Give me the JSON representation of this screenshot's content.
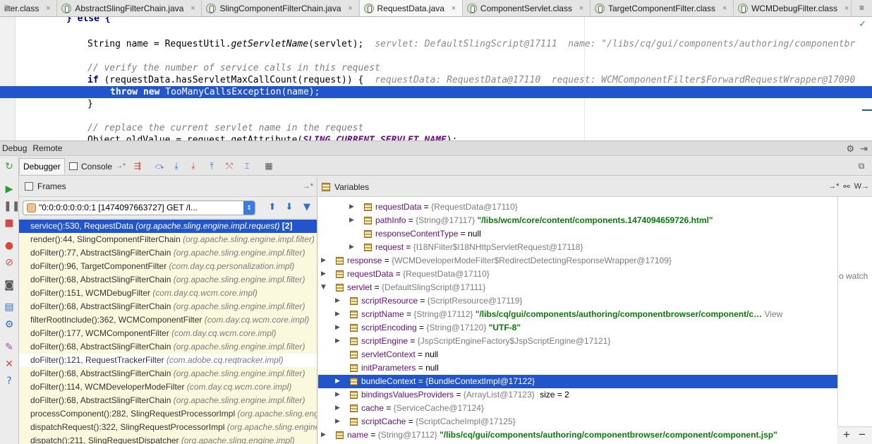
{
  "tabs": [
    {
      "label": "ilter.class",
      "active": false
    },
    {
      "label": "AbstractSlingFilterChain.java",
      "active": false
    },
    {
      "label": "SlingComponentFilterChain.java",
      "active": false
    },
    {
      "label": "RequestData.java",
      "active": true
    },
    {
      "label": "ComponentServlet.class",
      "active": false
    },
    {
      "label": "TargetComponentFilter.class",
      "active": false
    },
    {
      "label": "WCMDebugFilter.class",
      "active": false
    }
  ],
  "tab_overflow": "≡",
  "editor": {
    "line0": "} else {",
    "line1_code_a": "String name = RequestUtil.",
    "line1_method": "getServletName",
    "line1_code_b": "(servlet);",
    "line1_inline": "servlet: DefaultSlingScript@17111  name: \"/libs/cq/gui/components/authoring/componentbr",
    "line2_comment": "// verify the number of service calls in this request",
    "line3_kw": "if",
    "line3_code": " (requestData.hasServletMaxCallCount(request)) {",
    "line3_inline": "requestData: RequestData@17110  request: WCMComponentFilter$ForwardRequestWrapper@17090",
    "line4_kw": "throw new",
    "line4_code": " TooManyCallsException(name);",
    "line5": "}",
    "line6_comment": "// replace the current servlet name in the request",
    "line7_code": "Object oldValue = request.getAttribute(",
    "line7_const": "SLING_CURRENT_SERVLET_NAME",
    "line7_end": ");"
  },
  "debug_bar": {
    "title": "Debug",
    "config": "Remote"
  },
  "debugger_tabs": {
    "debugger": "Debugger",
    "console": "Console",
    "console_pin": "→*"
  },
  "frames": {
    "title": "Frames",
    "pin": "→*",
    "thread": "\"0:0:0:0:0:0:0:1 [1474097663727] GET /l...",
    "items": [
      {
        "method": "service():530, RequestData",
        "pkg": "(org.apache.sling.engine.impl.request)",
        "count": "[2]",
        "selected": true,
        "white": false
      },
      {
        "method": "render():44, SlingComponentFilterChain",
        "pkg": "(org.apache.sling.engine.impl.filter)",
        "count": "",
        "selected": false,
        "white": false
      },
      {
        "method": "doFilter():77, AbstractSlingFilterChain",
        "pkg": "(org.apache.sling.engine.impl.filter)",
        "count": "",
        "selected": false,
        "white": false
      },
      {
        "method": "doFilter():96, TargetComponentFilter",
        "pkg": "(com.day.cq.personalization.impl)",
        "count": "",
        "selected": false,
        "white": false
      },
      {
        "method": "doFilter():68, AbstractSlingFilterChain",
        "pkg": "(org.apache.sling.engine.impl.filter)",
        "count": "",
        "selected": false,
        "white": false
      },
      {
        "method": "doFilter():151, WCMDebugFilter",
        "pkg": "(com.day.cq.wcm.core.impl)",
        "count": "",
        "selected": false,
        "white": false
      },
      {
        "method": "doFilter():68, AbstractSlingFilterChain",
        "pkg": "(org.apache.sling.engine.impl.filter)",
        "count": "",
        "selected": false,
        "white": false
      },
      {
        "method": "filterRootInclude():362, WCMComponentFilter",
        "pkg": "(com.day.cq.wcm.core.impl)",
        "count": "",
        "selected": false,
        "white": false
      },
      {
        "method": "doFilter():177, WCMComponentFilter",
        "pkg": "(com.day.cq.wcm.core.impl)",
        "count": "",
        "selected": false,
        "white": false
      },
      {
        "method": "doFilter():68, AbstractSlingFilterChain",
        "pkg": "(org.apache.sling.engine.impl.filter)",
        "count": "",
        "selected": false,
        "white": false
      },
      {
        "method": "doFilter():121, RequestTrackerFilter",
        "pkg": "(com.adobe.cq.reqtracker.impl)",
        "count": "",
        "selected": false,
        "white": true
      },
      {
        "method": "doFilter():68, AbstractSlingFilterChain",
        "pkg": "(org.apache.sling.engine.impl.filter)",
        "count": "",
        "selected": false,
        "white": false
      },
      {
        "method": "doFilter():114, WCMDeveloperModeFilter",
        "pkg": "(com.day.cq.wcm.core.impl)",
        "count": "",
        "selected": false,
        "white": false
      },
      {
        "method": "doFilter():68, AbstractSlingFilterChain",
        "pkg": "(org.apache.sling.engine.impl.filter)",
        "count": "",
        "selected": false,
        "white": false
      },
      {
        "method": "processComponent():282, SlingRequestProcessorImpl",
        "pkg": "(org.apache.sling.engine.impl)",
        "count": "",
        "selected": false,
        "white": false
      },
      {
        "method": "dispatchRequest():322, SlingRequestProcessorImpl",
        "pkg": "(org.apache.sling.engine.impl)",
        "count": "",
        "selected": false,
        "white": false
      },
      {
        "method": "dispatch():211, SlingRequestDispatcher",
        "pkg": "(org.apache.sling.engine.impl)",
        "count": "",
        "selected": false,
        "white": false
      }
    ]
  },
  "variables": {
    "title": "Variables",
    "pin": "→*",
    "watches_short": "W→",
    "watch_hint": "o watch",
    "items": [
      {
        "depth": 2,
        "expandable": true,
        "name": "requestData",
        "type": "{RequestData@17110}",
        "value": "",
        "extra": "",
        "selected": false
      },
      {
        "depth": 2,
        "expandable": true,
        "name": "pathInfo",
        "type": "{String@17117}",
        "value": "\"/libs/wcm/core/content/components.1474094659726.html\"",
        "extra": "",
        "selected": false
      },
      {
        "depth": 2,
        "expandable": false,
        "name": "responseContentType",
        "type": "",
        "value": "null",
        "extra": "",
        "selected": false
      },
      {
        "depth": 2,
        "expandable": true,
        "name": "request",
        "type": "{I18NFilter$I18NHttpServletRequest@17118}",
        "value": "",
        "extra": "",
        "selected": false
      },
      {
        "depth": 0,
        "expandable": true,
        "name": "response",
        "type": "{WCMDeveloperModeFilter$RedirectDetectingResponseWrapper@17109}",
        "value": "",
        "extra": "",
        "selected": false
      },
      {
        "depth": 0,
        "expandable": true,
        "name": "requestData",
        "type": "{RequestData@17110}",
        "value": "",
        "extra": "",
        "selected": false
      },
      {
        "depth": 0,
        "expandable": true,
        "expanded": true,
        "name": "servlet",
        "type": "{DefaultSlingScript@17111}",
        "value": "",
        "extra": "",
        "selected": false
      },
      {
        "depth": 1,
        "expandable": true,
        "name": "scriptResource",
        "type": "{ScriptResource@17119}",
        "value": "",
        "extra": "",
        "selected": false
      },
      {
        "depth": 1,
        "expandable": true,
        "name": "scriptName",
        "type": "{String@17112}",
        "value": "\"/libs/cq/gui/components/authoring/componentbrowser/component/c…",
        "extra": "View",
        "selected": false
      },
      {
        "depth": 1,
        "expandable": true,
        "name": "scriptEncoding",
        "type": "{String@17120}",
        "value": "\"UTF-8\"",
        "extra": "",
        "selected": false
      },
      {
        "depth": 1,
        "expandable": true,
        "name": "scriptEngine",
        "type": "{JspScriptEngineFactory$JspScriptEngine@17121}",
        "value": "",
        "extra": "",
        "selected": false
      },
      {
        "depth": 1,
        "expandable": false,
        "name": "servletContext",
        "type": "",
        "value": "null",
        "extra": "",
        "selected": false
      },
      {
        "depth": 1,
        "expandable": false,
        "name": "initParameters",
        "type": "",
        "value": "null",
        "extra": "",
        "selected": false
      },
      {
        "depth": 1,
        "expandable": true,
        "name": "bundleContext",
        "type": "{BundleContextImpl@17122}",
        "value": "",
        "extra": "",
        "selected": true
      },
      {
        "depth": 1,
        "expandable": true,
        "name": "bindingsValuesProviders",
        "type": "{ArrayList@17123}",
        "value": "size = 2",
        "extra": "",
        "selected": false
      },
      {
        "depth": 1,
        "expandable": true,
        "name": "cache",
        "type": "{ServiceCache@17124}",
        "value": "",
        "extra": "",
        "selected": false
      },
      {
        "depth": 1,
        "expandable": true,
        "name": "scriptCache",
        "type": "{ScriptCacheImpl@17125}",
        "value": "",
        "extra": "",
        "selected": false
      },
      {
        "depth": 0,
        "expandable": true,
        "name": "name",
        "type": "{String@17112}",
        "value": "\"/libs/cq/gui/components/authoring/componentbrowser/component/component.jsp\"",
        "extra": "",
        "selected": false
      }
    ]
  }
}
